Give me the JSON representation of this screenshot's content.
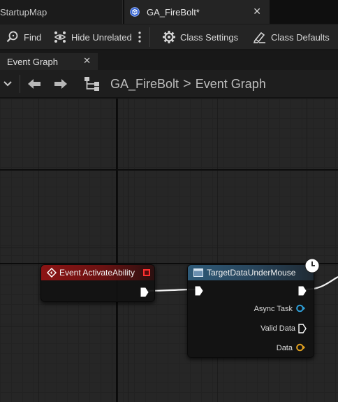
{
  "doc_tabs": [
    {
      "label": "StartupMap",
      "active": false
    },
    {
      "label": "GA_FireBolt*",
      "active": true
    }
  ],
  "toolbar": {
    "find_label": "Find",
    "hide_unrelated_label": "Hide Unrelated",
    "class_settings_label": "Class Settings",
    "class_defaults_label": "Class Defaults"
  },
  "graph_tab": {
    "label": "Event Graph"
  },
  "breadcrumb": {
    "blueprint": "GA_FireBolt",
    "separator": ">",
    "graph": "Event Graph"
  },
  "nodes": {
    "event_activate": {
      "title": "Event ActivateAbility"
    },
    "target_data": {
      "title": "TargetDataUnderMouse",
      "pins": {
        "async_task": "Async Task",
        "valid_data": "Valid Data",
        "data": "Data"
      }
    }
  },
  "colors": {
    "event_header": "#8c1414",
    "task_header": "#2e5a78",
    "async_pin": "#2f9fd8",
    "data_pin": "#e0a020",
    "exec_pin": "#ffffff"
  }
}
